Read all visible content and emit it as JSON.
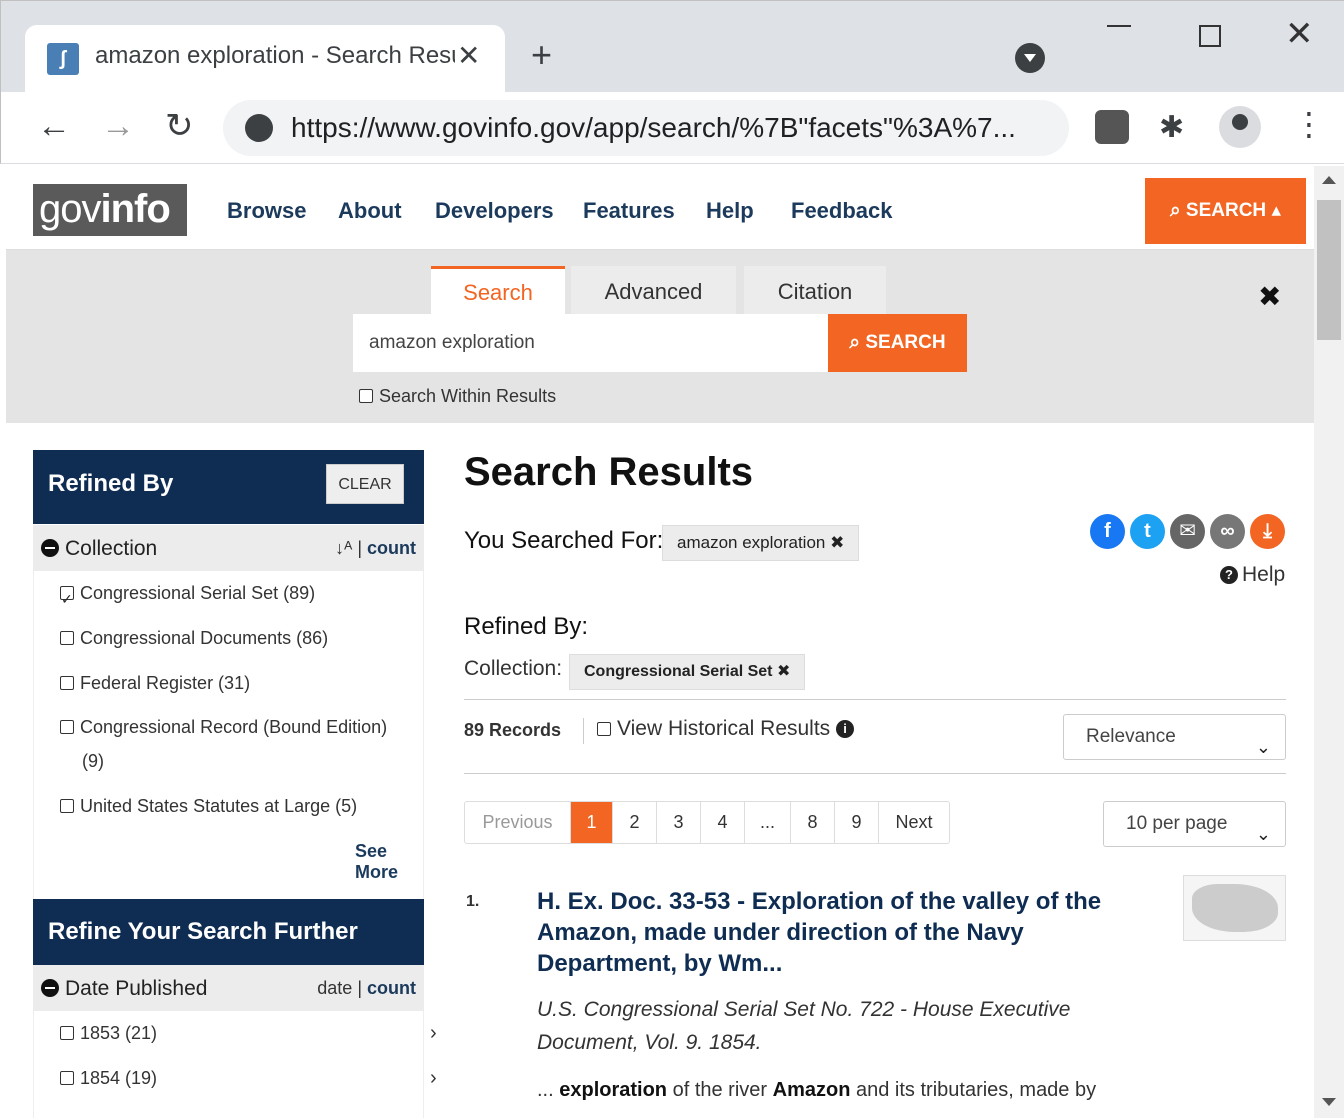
{
  "browser": {
    "tab_title": "amazon exploration - Search Resu",
    "url": "https://www.govinfo.gov/app/search/%7B\"facets\"%3A%7..."
  },
  "header": {
    "logo_prefix": "gov",
    "logo_suffix": "info",
    "nav": [
      "Browse",
      "About",
      "Developers",
      "Features",
      "Help",
      "Feedback"
    ],
    "search_label": "SEARCH"
  },
  "search_panel": {
    "tabs": [
      "Search",
      "Advanced",
      "Citation"
    ],
    "query": "amazon exploration",
    "button": "SEARCH",
    "within_label": "Search Within Results"
  },
  "sidebar": {
    "refined_title": "Refined By",
    "clear_label": "CLEAR",
    "collection": {
      "title": "Collection",
      "sort": "count",
      "items": [
        {
          "label": "Congressional Serial Set (89)",
          "checked": true
        },
        {
          "label": "Congressional Documents (86)",
          "checked": false
        },
        {
          "label": "Federal Register (31)",
          "checked": false
        },
        {
          "label": "Congressional Record (Bound Edition)",
          "checked": false
        },
        {
          "label": "(9)",
          "checked": false
        },
        {
          "label": "United States Statutes at Large (5)",
          "checked": false
        }
      ],
      "see_more": "See More"
    },
    "further_title": "Refine Your Search Further",
    "date": {
      "title": "Date Published",
      "sort_a": "date",
      "sort_b": "count",
      "items": [
        "1853 (21)",
        "1854 (19)"
      ]
    }
  },
  "main": {
    "heading": "Search Results",
    "you_searched_label": "You Searched For:",
    "query_chip": "amazon exploration",
    "help_label": "Help",
    "refined_by_label": "Refined By:",
    "collection_label": "Collection:",
    "collection_chip": "Congressional Serial Set",
    "records": "89 Records",
    "historical_label": "View Historical Results",
    "sort_value": "Relevance",
    "per_page_value": "10 per page",
    "pager": [
      "Previous",
      "1",
      "2",
      "3",
      "4",
      "...",
      "8",
      "9",
      "Next"
    ],
    "result": {
      "number": "1.",
      "title": "H. Ex. Doc. 33-53 - Exploration of the valley of the Amazon, made under direction of the Navy Department, by Wm...",
      "subtitle": "U.S. Congressional Serial Set No. 722 - House Executive Document, Vol. 9. 1854.",
      "snippet_1": "exploration",
      "snippet_2": " of the river ",
      "snippet_3": "Amazon",
      "snippet_4": " and its tributaries, made by"
    }
  }
}
